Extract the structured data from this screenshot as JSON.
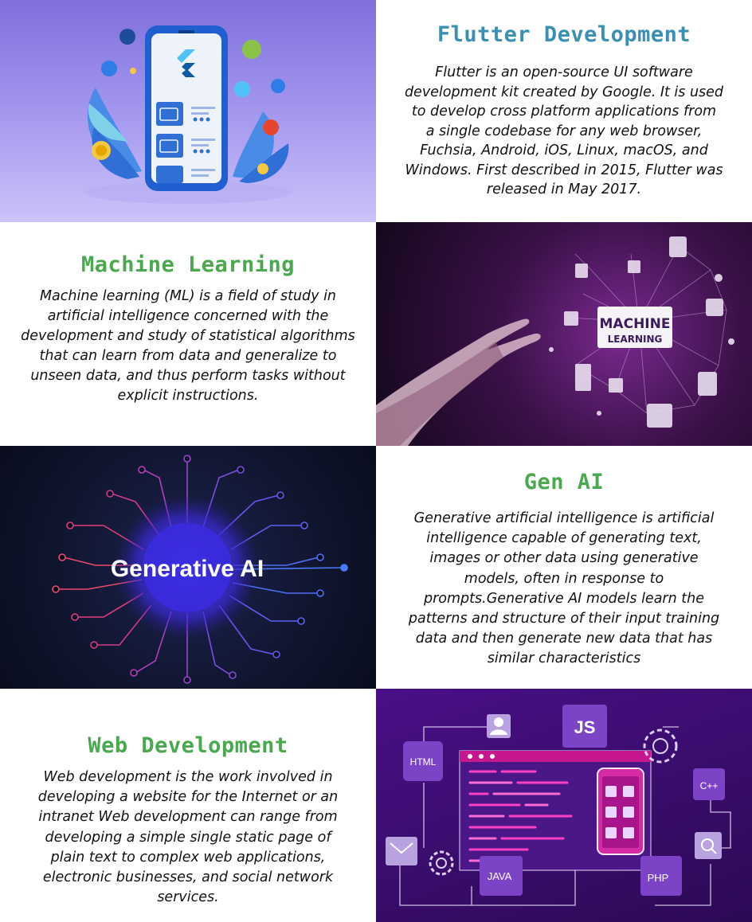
{
  "colors": {
    "flutter_title": "#3a8fb3",
    "section_title": "#4aa84f",
    "body_text": "#111111",
    "flutter_bg": "#9a8ee6",
    "ml_bg": "#2a0f34",
    "genai_bg": "#0f1430",
    "web_bg": "#3b0d6e"
  },
  "sections": {
    "flutter": {
      "title": "Flutter Development",
      "lines": [
        "Flutter is an open-source UI software",
        "development kit created by Google. It is used",
        "to develop cross platform applications from",
        "a single codebase for any web browser,",
        "Fuchsia, Android, iOS, Linux, macOS, and",
        "Windows. First described in 2015, Flutter was",
        "released in May 2017."
      ],
      "image_icon": "mobile-app-illustration"
    },
    "ml": {
      "title": "Machine Learning",
      "lines": [
        "Machine learning (ML) is a field of study in",
        "artificial intelligence concerned with the",
        "development and study of statistical algorithms",
        "that can learn from data and generalize to",
        "unseen data, and thus perform tasks without",
        "explicit instructions."
      ],
      "image_label_1": "MACHINE",
      "image_label_2": "LEARNING",
      "image_icon": "hand-touching-network-illustration"
    },
    "genai": {
      "title": "Gen AI",
      "lines": [
        "Generative artificial intelligence is artificial",
        "intelligence capable of generating text,",
        "images or other data using generative",
        "models, often in response to",
        "prompts.Generative AI models learn the",
        "patterns and structure of their input training",
        "data and then generate new data that has",
        "similar characteristics"
      ],
      "image_label": "Generative AI",
      "image_icon": "neural-circuit-illustration"
    },
    "web": {
      "title": "Web Development",
      "lines": [
        "Web development is the work involved in",
        "developing a website for the Internet  or an",
        "intranet Web development can range from",
        "developing a simple single static page of",
        "plain text to complex web applications,",
        "electronic businesses, and social network",
        "services."
      ],
      "tags": {
        "html": "HTML",
        "js": "JS",
        "cpp": "C++",
        "java": "JAVA",
        "php": "PHP"
      },
      "image_icon": "web-development-illustration"
    }
  }
}
